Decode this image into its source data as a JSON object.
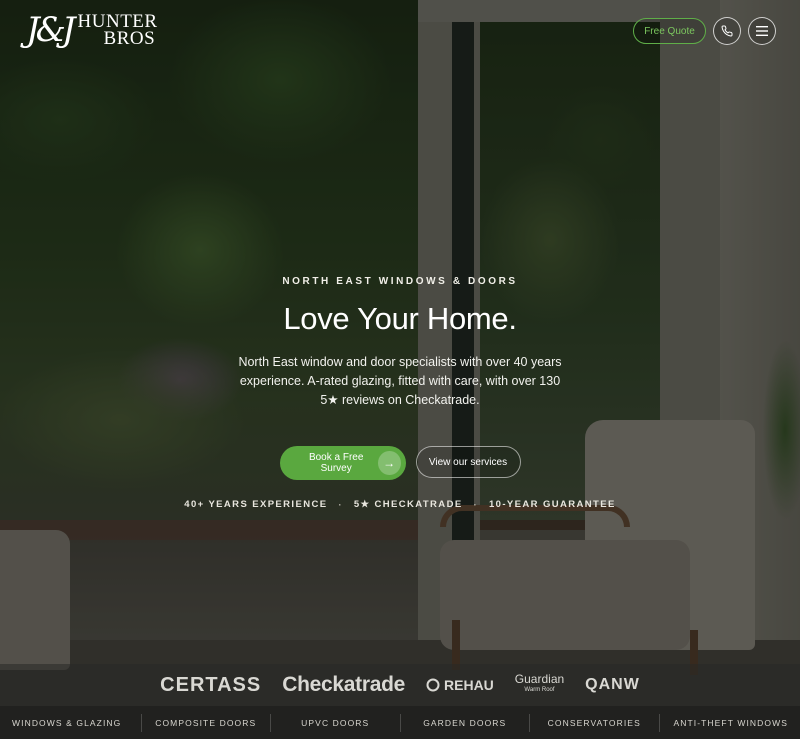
{
  "header": {
    "logo_mark": "J&J",
    "logo_line1": "HUNTER",
    "logo_line2": "BROS",
    "quote_button": "Free Quote",
    "phone_icon": "phone-icon",
    "menu_icon": "hamburger-menu-icon"
  },
  "hero": {
    "eyebrow": "NORTH EAST WINDOWS & DOORS",
    "title": "Love Your Home.",
    "description": "North East window and door specialists with over 40 years experience. A-rated glazing, fitted with care, with over 130 5★ reviews on Checkatrade.",
    "primary_cta": "Book a Free Survey",
    "secondary_cta": "View our services",
    "trust": [
      "40+ YEARS EXPERIENCE",
      "5★ CHECKATRADE",
      "10-YEAR GUARANTEE"
    ]
  },
  "partners": {
    "certass": "CERTASS",
    "checkatrade": "Checkatrade",
    "rehau": "REHAU",
    "guardian": "Guardian",
    "guardian_sub": "Warm Roof",
    "qanw": "QANW"
  },
  "categories": [
    "WINDOWS & GLAZING",
    "COMPOSITE DOORS",
    "UPVC DOORS",
    "GARDEN DOORS",
    "CONSERVATORIES",
    "ANTI-THEFT WINDOWS"
  ],
  "colors": {
    "accent": "#5aa83f",
    "quote_text": "#7cc75f"
  }
}
